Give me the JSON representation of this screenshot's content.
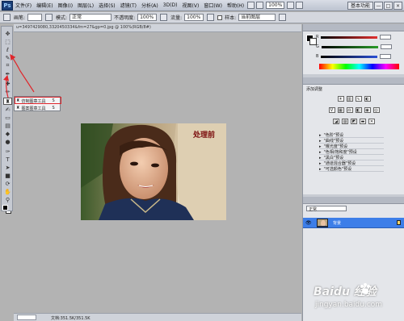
{
  "app": {
    "logo": "Ps"
  },
  "menubar": {
    "items": [
      "文件(F)",
      "编辑(E)",
      "图像(I)",
      "图层(L)",
      "选择(S)",
      "滤镜(T)",
      "分析(A)",
      "3D(D)",
      "视图(V)",
      "窗口(W)",
      "帮助(H)"
    ],
    "zoom": "100%",
    "workspace": "基本功能",
    "controls": [
      "—",
      "□",
      "×"
    ]
  },
  "options": {
    "brush_label": "画笔:",
    "mode_label": "模式:",
    "mode_value": "正常",
    "opacity_label": "不透明度:",
    "opacity_value": "100%",
    "flow_label": "流量:",
    "flow_value": "100%",
    "sample_label": "样本:",
    "sample_value": "当前图层"
  },
  "document": {
    "tab_title": "u=3497429080,3320450334&fm=27&gp=0.jpg @ 100%(RGB/8#)",
    "canvas_label": "处理前",
    "status": "文档:351.5K/351.5K"
  },
  "flyout": {
    "items": [
      {
        "icon": "clone-stamp-icon",
        "label": "仿制图章工具",
        "key": "S"
      },
      {
        "icon": "pattern-stamp-icon",
        "label": "图案图章工具",
        "key": "S"
      }
    ]
  },
  "color_panel": {
    "channels": [
      "R",
      "G",
      "B"
    ],
    "colors": {
      "R": "#e23030",
      "G": "#2a9c2a",
      "B": "#2a4fd6"
    }
  },
  "adjustments_panel": {
    "title": "添加调整",
    "presets": [
      "\"色阶\"预设",
      "\"曲线\"预设",
      "\"曝光度\"预设",
      "\"色相/饱和度\"预设",
      "\"黑白\"预设",
      "\"通道混合器\"预设",
      "\"可选颜色\"预设"
    ]
  },
  "layers_panel": {
    "blend_mode": "正常",
    "layer_name": "背景"
  },
  "watermark": {
    "brand": "Baidu 经验",
    "url": "jingyan.baidu.com"
  },
  "accent": {
    "annotation_red": "#e0262b",
    "selection_blue": "#3d7ee8"
  }
}
